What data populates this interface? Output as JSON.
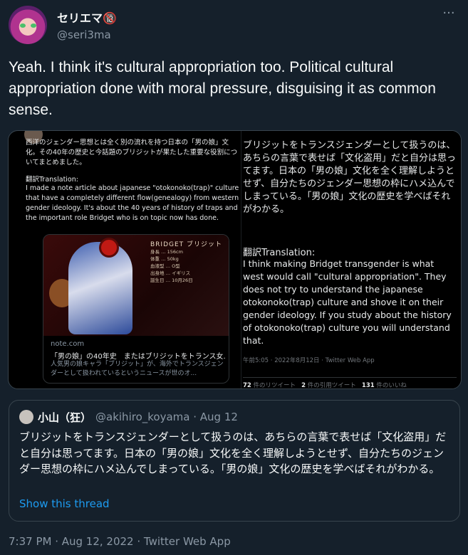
{
  "author": {
    "display_name": "セリエマ🔞",
    "handle": "@seri3ma"
  },
  "tweet": {
    "text": "Yeah. I think it's cultural appropriation too. Political cultural appropriation done with moral pressure, disguising it as common sense."
  },
  "embedded_screenshot": {
    "left_post": {
      "jp_text": "西洋のジェンダー思想とは全く別の流れを持つ日本の「男の娘」文化。その40年の歴史と今話題のブリジットが果たした重要な役割についてまとめました。",
      "translation_heading": "翻訳Translation:",
      "translation_text": "I made a note article about japanese \"otokonoko(trap)\" culture that have a completely different flow(genealogy) from western gender ideology. It's about the 40 years of history of traps and the important role Bridget who is on topic now has done.",
      "card": {
        "panel_title": "BRIDGET ブリジット",
        "stats": [
          "身長 … 156cm",
          "体重 … 50kg",
          "血液型 … O型",
          "出身地 … イギリス",
          "誕生日 … 10月26日"
        ],
        "site": "note.com",
        "title": "「男の娘」の40年史　またはブリジットをトランス女...",
        "description": "人気男の娘キャラ「ブリジット」が、海外でトランスジェンダーとして扱われているというニュースが世のオ..."
      }
    },
    "right_post": {
      "jp_text": "ブリジットをトランスジェンダーとして扱うのは、あちらの言葉で表せば「文化盗用」だと自分は思ってます。日本の「男の娘」文化を全く理解しようとせず、自分たちのジェンダー思想の枠にハメ込んでしまっている。「男の娘」文化の歴史を学べばそれがわかる。",
      "translation_heading": "翻訳Translation:",
      "translation_text": "I think making Bridget transgender is what west would call \"cultural appropriation\". They does not try to understand the japanese otokonoko(trap) culture and shove it on their gender ideology. If you study about the history of otokonoko(trap) culture you will understand that.",
      "meta": "午前5:05 · 2022年8月12日 · Twitter Web App",
      "retweets": "72",
      "retweets_label": "件のリツイート",
      "quotes": "2",
      "quotes_label": "件の引用ツイート",
      "likes": "131",
      "likes_label": "件のいいね"
    }
  },
  "quoted_tweet": {
    "display_name": "小山（狂）",
    "handle": "@akihiro_koyama · Aug 12",
    "text": "ブリジットをトランスジェンダーとして扱うのは、あちらの言葉で表せば「文化盗用」だと自分は思ってます。日本の「男の娘」文化を全く理解しようとせず、自分たちのジェンダー思想の枠にハメ込んでしまっている。「男の娘」文化の歴史を学べばそれがわかる。",
    "show_thread": "Show this thread"
  },
  "footer": {
    "meta": "7:37 PM · Aug 12, 2022 · Twitter Web App"
  },
  "colors": {
    "background": "#15202b",
    "accent": "#1d9bf0",
    "secondary_text": "#8b98a5"
  }
}
